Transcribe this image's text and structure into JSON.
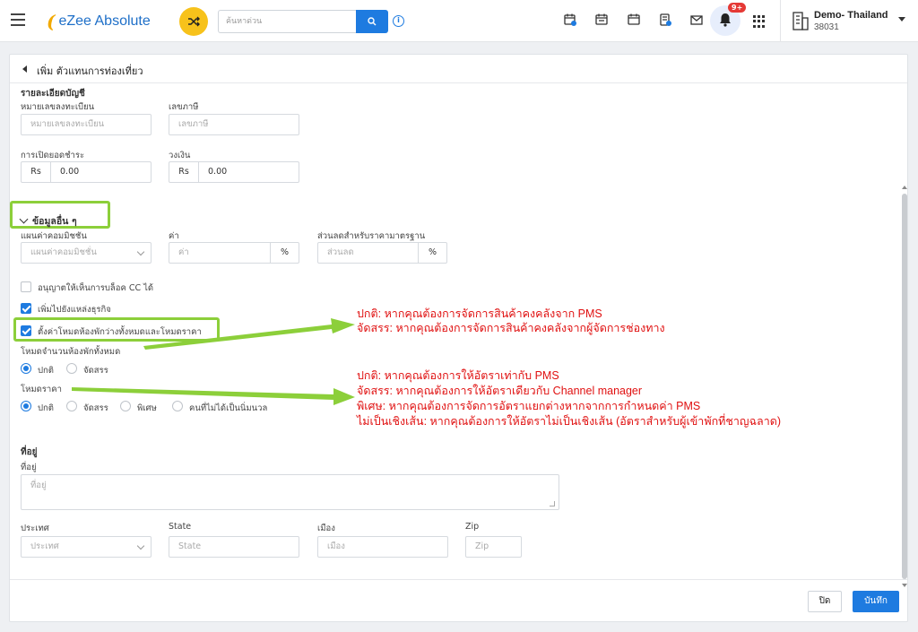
{
  "topbar": {
    "app_name": "eZee Absolute",
    "search_placeholder": "ค้นหาด่วน",
    "notifications_badge": "9+",
    "property_name": "Demo- Thailand",
    "property_code": "38031"
  },
  "page": {
    "title": "เพิ่ม ตัวแทนการท่องเที่ยว"
  },
  "account": {
    "section_title": "รายละเอียดบัญชี",
    "reg_no_label": "หมายเลขลงทะเบียน",
    "reg_no_placeholder": "หมายเลขลงทะเบียน",
    "tax_no_label": "เลขภาษี",
    "tax_no_placeholder": "เลขภาษี",
    "opening_balance_label": "การเปิดยอดชำระ",
    "opening_balance_currency": "Rs",
    "opening_balance_value": "0.00",
    "credit_limit_label": "วงเงิน",
    "credit_limit_currency": "Rs",
    "credit_limit_value": "0.00"
  },
  "other": {
    "section_title": "ข้อมูลอื่น ๆ",
    "commission_plan_label": "แผนค่าคอมมิชชัน",
    "commission_plan_placeholder": "แผนค่าคอมมิชชั่น",
    "value_label": "ค่า",
    "value_placeholder": "ค่า",
    "value_suffix": "%",
    "discount_label": "ส่วนลดสำหรับราคามาตรฐาน",
    "discount_placeholder": "ส่วนลด",
    "discount_suffix": "%",
    "allow_cc_label": "อนุญาตให้เห็นการบล็อค CC ได้",
    "allow_cc_checked": false,
    "add_business_source_label": "เพิ่มไปยังแหล่งธุรกิจ",
    "add_business_source_checked": true,
    "set_all_modes_label": "ตั้งค่าโหมดห้องพักว่างทั้งหมดและโหมดราคา",
    "set_all_modes_checked": true,
    "inventory_mode_label": "โหมดจำนวนห้องพักทั้งหมด",
    "inventory_mode_options": [
      "ปกติ",
      "จัดสรร"
    ],
    "inventory_mode_selected": "ปกติ",
    "rate_mode_label": "โหมดราคา",
    "rate_mode_options": [
      "ปกติ",
      "จัดสรร",
      "พิเศษ",
      "คนที่ไม่ได้เป็นนิ่มนวล"
    ],
    "rate_mode_selected": "ปกติ"
  },
  "annotations": {
    "inventory": [
      "ปกติ: หากคุณต้องการจัดการสินค้าคงคลังจาก PMS",
      "จัดสรร: หากคุณต้องการจัดการสินค้าคงคลังจากผู้จัดการช่องทาง"
    ],
    "rate": [
      "ปกติ: หากคุณต้องการให้อัตราเท่ากับ PMS",
      "จัดสรร: หากคุณต้องการให้อัตราเดียวกับ Channel manager",
      "พิเศษ: หากคุณต้องการจัดการอัตราแยกต่างหากจากการกำหนดค่า PMS",
      "ไม่เป็นเชิงเส้น: หากคุณต้องการให้อัตราไม่เป็นเชิงเส้น (อัตราสำหรับผู้เข้าพักที่ชาญฉลาด)"
    ],
    "color": "#e01010",
    "highlight_color": "#8ccf3a"
  },
  "address": {
    "section_title": "ที่อยู่",
    "address_label": "ที่อยู่",
    "address_placeholder": "ที่อยู่",
    "country_label": "ประเทศ",
    "country_placeholder": "ประเทศ",
    "state_label": "State",
    "state_placeholder": "State",
    "city_label": "เมือง",
    "city_placeholder": "เมือง",
    "zip_label": "Zip",
    "zip_placeholder": "Zip"
  },
  "footer": {
    "close_label": "ปิด",
    "save_label": "บันทึก"
  },
  "colors": {
    "primary": "#1e7be0",
    "accent_yellow": "#f7c21b",
    "badge_red": "#e53935"
  }
}
